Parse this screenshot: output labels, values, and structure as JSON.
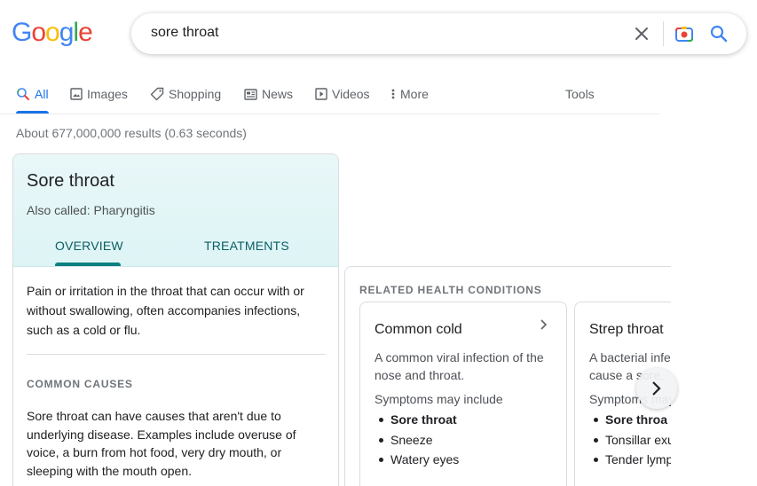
{
  "logo": {
    "letters": [
      "G",
      "o",
      "o",
      "g",
      "l",
      "e"
    ],
    "colors": [
      "#4285f4",
      "#ea4335",
      "#fbbc05",
      "#4285f4",
      "#34a853",
      "#ea4335"
    ]
  },
  "search": {
    "query": "sore throat"
  },
  "tabs": [
    {
      "label": "All",
      "icon": "search-icon",
      "active": true
    },
    {
      "label": "Images",
      "icon": "image-icon"
    },
    {
      "label": "Shopping",
      "icon": "tag-icon"
    },
    {
      "label": "News",
      "icon": "news-icon"
    },
    {
      "label": "Videos",
      "icon": "video-icon"
    },
    {
      "label": "More",
      "icon": "more-vert-icon"
    }
  ],
  "tools_label": "Tools",
  "results_stats": "About 677,000,000 results (0.63 seconds)",
  "knowledge_panel": {
    "title": "Sore throat",
    "also_called": "Also called: Pharyngitis",
    "tabs": [
      "OVERVIEW",
      "TREATMENTS"
    ],
    "description": "Pain or irritation in the throat that can occur with or without swallowing, often accompanies infections, such as a cold or flu.",
    "causes_heading": "COMMON CAUSES",
    "causes_text": "Sore throat can have causes that aren't due to underlying disease. Examples include overuse of voice, a burn from hot food, very dry mouth, or sleeping with the mouth open."
  },
  "related": {
    "heading": "RELATED HEALTH CONDITIONS",
    "cards": [
      {
        "title": "Common cold",
        "desc_line1": "A common viral infection of the",
        "desc_line2": "nose and throat.",
        "symptoms_label": "Symptoms may include",
        "symptoms": [
          "Sore throat",
          "Sneeze",
          "Watery eyes"
        ]
      },
      {
        "title": "Strep throat",
        "desc_line1": "A bacterial infe",
        "desc_line2": "cause a sore,",
        "symptoms_label": "Symptoms may",
        "symptoms": [
          "Sore throa",
          "Tonsillar exu",
          "Tender lymp"
        ]
      }
    ]
  },
  "colors": {
    "accent": "#1a73e8",
    "teal": "#0b7f7f",
    "panel_bg": "#e3f6f7"
  }
}
